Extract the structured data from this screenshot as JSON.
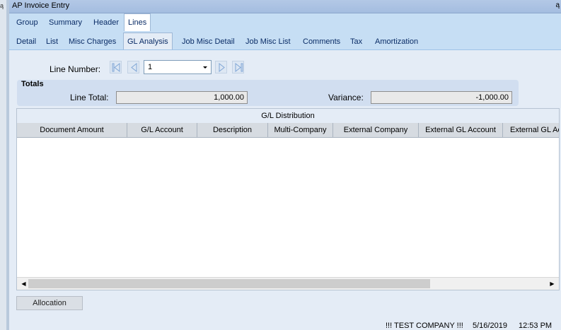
{
  "window": {
    "title": "AP Invoice Entry"
  },
  "tabs_primary": [
    {
      "label": "Group",
      "active": false
    },
    {
      "label": "Summary",
      "active": false
    },
    {
      "label": "Header",
      "active": false
    },
    {
      "label": "Lines",
      "active": true
    }
  ],
  "tabs_secondary": [
    {
      "label": "Detail",
      "active": false
    },
    {
      "label": "List",
      "active": false
    },
    {
      "label": "Misc Charges",
      "active": false
    },
    {
      "label": "GL Analysis",
      "active": true
    },
    {
      "label": "Job Misc Detail",
      "active": false
    },
    {
      "label": "Job Misc List",
      "active": false
    },
    {
      "label": "Comments",
      "active": false
    },
    {
      "label": "Tax",
      "active": false
    },
    {
      "label": "Amortization",
      "active": false
    }
  ],
  "line_nav": {
    "label": "Line Number:",
    "value": "1",
    "buttons": [
      "first-icon",
      "prev-icon",
      "next-icon",
      "last-icon"
    ]
  },
  "totals": {
    "heading": "Totals",
    "line_total_label": "Line Total:",
    "line_total_value": "1,000.00",
    "variance_label": "Variance:",
    "variance_value": "-1,000.00"
  },
  "grid": {
    "title": "G/L Distribution",
    "columns": [
      "Document Amount",
      "G/L Account",
      "Description",
      "Multi-Company",
      "External Company",
      "External GL Account",
      "External GL Ac"
    ],
    "rows": []
  },
  "buttons": {
    "allocation": "Allocation"
  },
  "status": {
    "company": "!!! TEST COMPANY !!!",
    "date": "5/16/2019",
    "time": "12:53 PM"
  },
  "colors": {
    "accent_tab": "#c6def4",
    "title_bar": "#a4bde0",
    "nav_icon": "#7fa6d6"
  }
}
